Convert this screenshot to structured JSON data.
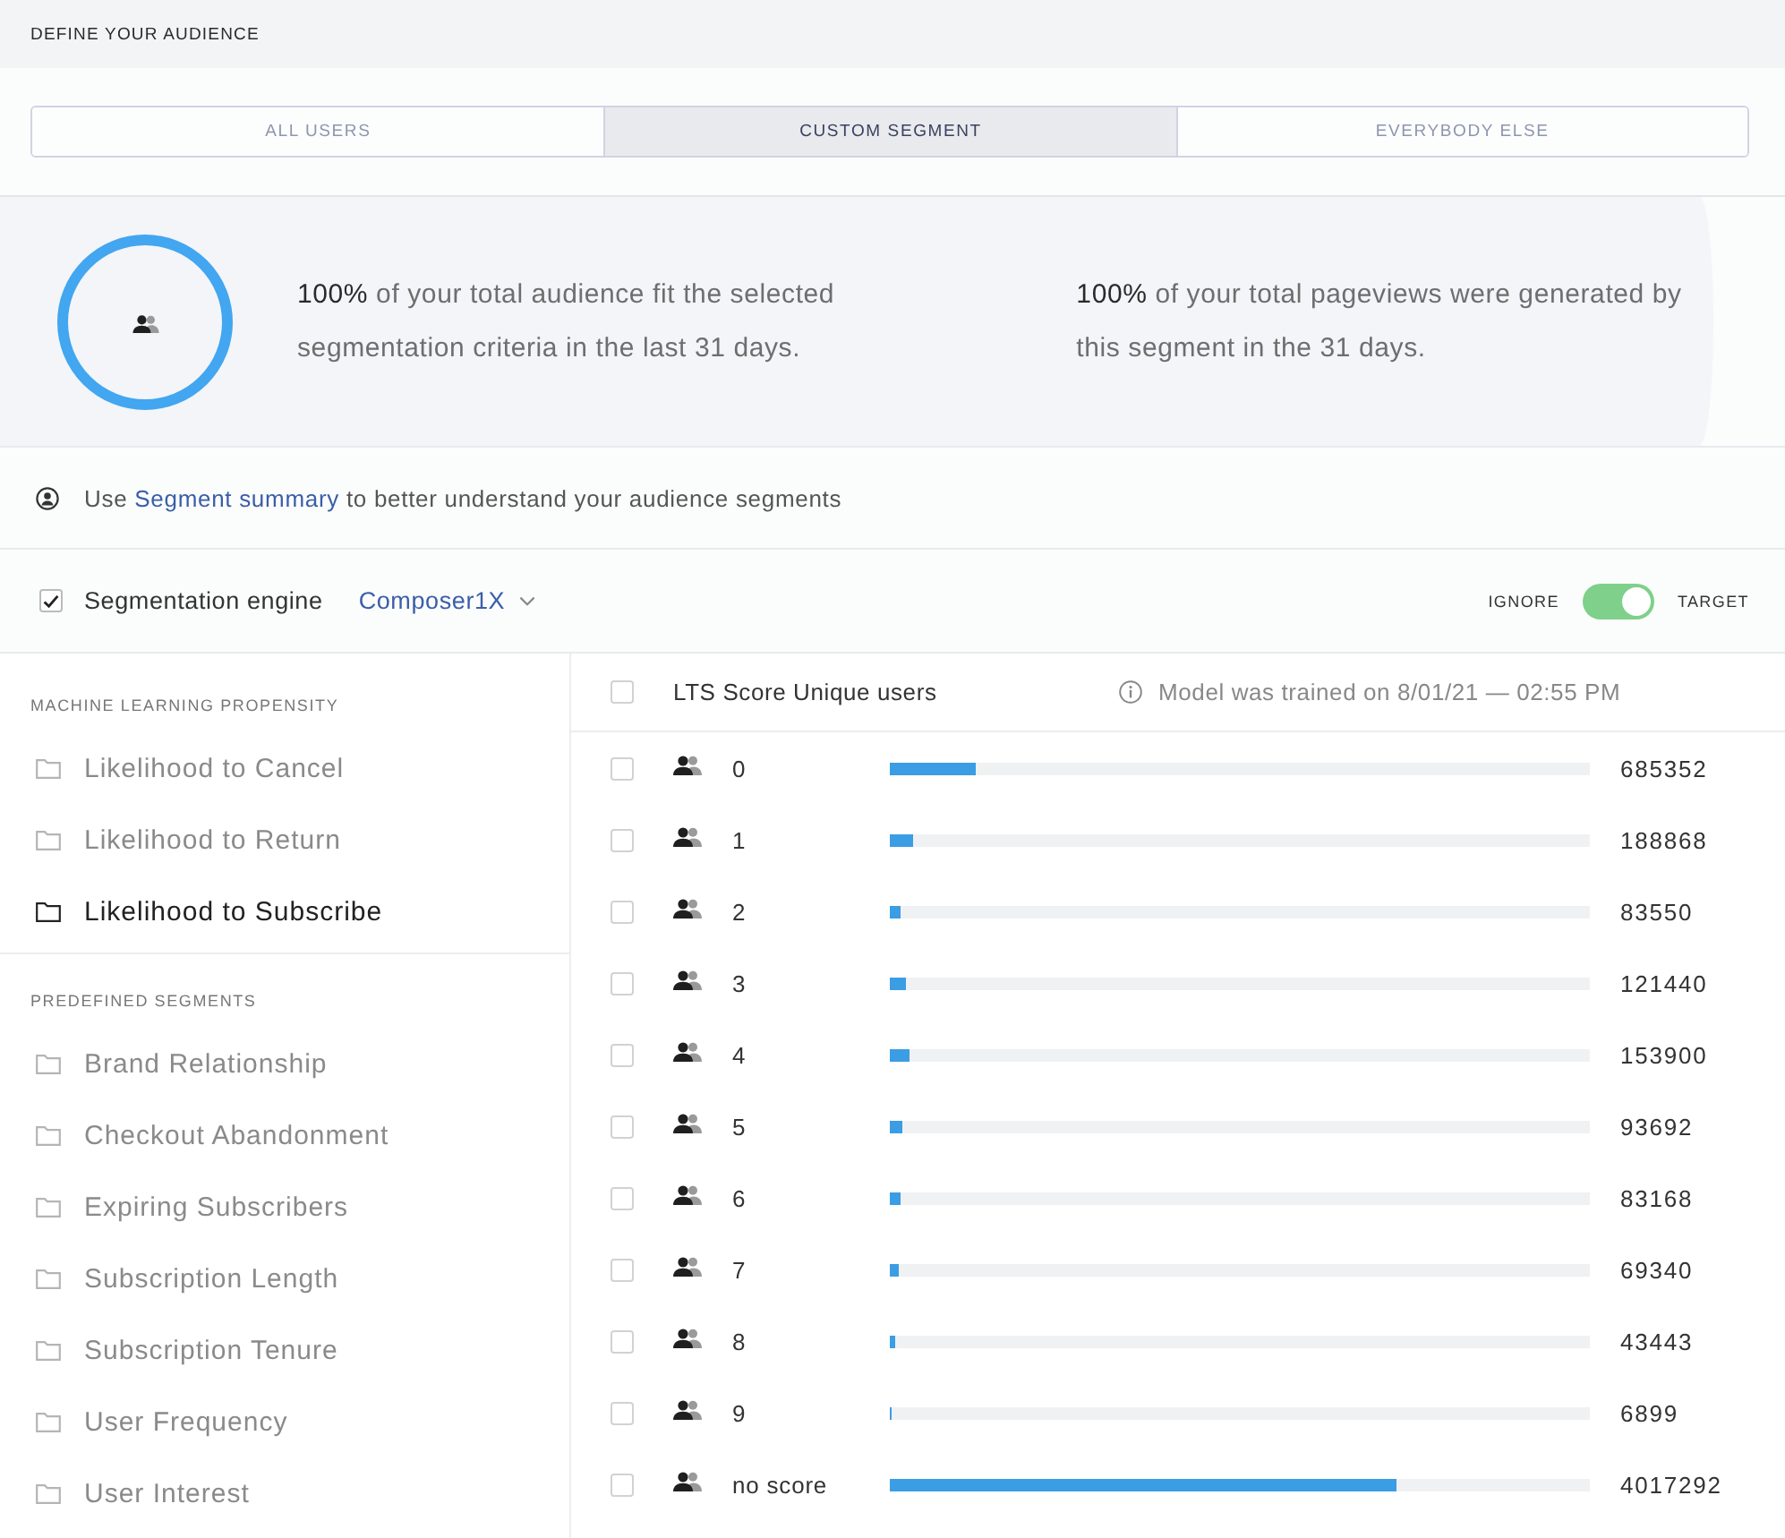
{
  "header": {
    "title": "DEFINE YOUR AUDIENCE"
  },
  "tabs": [
    {
      "label": "ALL USERS",
      "selected": false
    },
    {
      "label": "CUSTOM SEGMENT",
      "selected": true
    },
    {
      "label": "EVERYBODY ELSE",
      "selected": false
    }
  ],
  "summary": {
    "stats": [
      "**100%** of your total audience fit the selected segmentation criteria in the last 31 days.",
      "**100%** of your total pageviews were generated by this segment in the 31 days."
    ]
  },
  "info": {
    "text_before": "Use",
    "link": "Segment summary",
    "text_after": "to better understand your audience segments"
  },
  "engine": {
    "checked": true,
    "label": "Segmentation engine",
    "model": "Composer1X",
    "toggle": {
      "off_label": "IGNORE",
      "on_label": "TARGET",
      "on": true
    }
  },
  "sidebar": {
    "sections": [
      {
        "title": "MACHINE LEARNING PROPENSITY",
        "items": [
          {
            "label": "Likelihood to Cancel",
            "selected": false
          },
          {
            "label": "Likelihood to Return",
            "selected": false
          },
          {
            "label": "Likelihood to Subscribe",
            "selected": true
          }
        ]
      },
      {
        "title": "PREDEFINED SEGMENTS",
        "items": [
          {
            "label": "Brand Relationship",
            "selected": false
          },
          {
            "label": "Checkout Abandonment",
            "selected": false
          },
          {
            "label": "Expiring Subscribers",
            "selected": false
          },
          {
            "label": "Subscription Length",
            "selected": false
          },
          {
            "label": "Subscription Tenure",
            "selected": false
          },
          {
            "label": "User Frequency",
            "selected": false
          },
          {
            "label": "User Interest",
            "selected": false
          }
        ]
      }
    ]
  },
  "table": {
    "header": {
      "checked": false,
      "title": "LTS Score Unique users",
      "note": "Model was trained on 8/01/21 — 02:55 PM"
    },
    "rows": [
      {
        "checked": false,
        "score": "0",
        "level": 0.1236,
        "users": "685352"
      },
      {
        "checked": false,
        "score": "1",
        "level": 0.034,
        "users": "188868"
      },
      {
        "checked": false,
        "score": "2",
        "level": 0.0151,
        "users": "83550"
      },
      {
        "checked": false,
        "score": "3",
        "level": 0.0219,
        "users": "121440"
      },
      {
        "checked": false,
        "score": "4",
        "level": 0.0277,
        "users": "153900"
      },
      {
        "checked": false,
        "score": "5",
        "level": 0.0169,
        "users": "93692"
      },
      {
        "checked": false,
        "score": "6",
        "level": 0.015,
        "users": "83168"
      },
      {
        "checked": false,
        "score": "7",
        "level": 0.0125,
        "users": "69340"
      },
      {
        "checked": false,
        "score": "8",
        "level": 0.0078,
        "users": "43443"
      },
      {
        "checked": false,
        "score": "9",
        "level": 0.0012,
        "users": "6899"
      },
      {
        "checked": false,
        "score": "no score",
        "level": 0.7242,
        "users": "4017292"
      }
    ]
  }
}
